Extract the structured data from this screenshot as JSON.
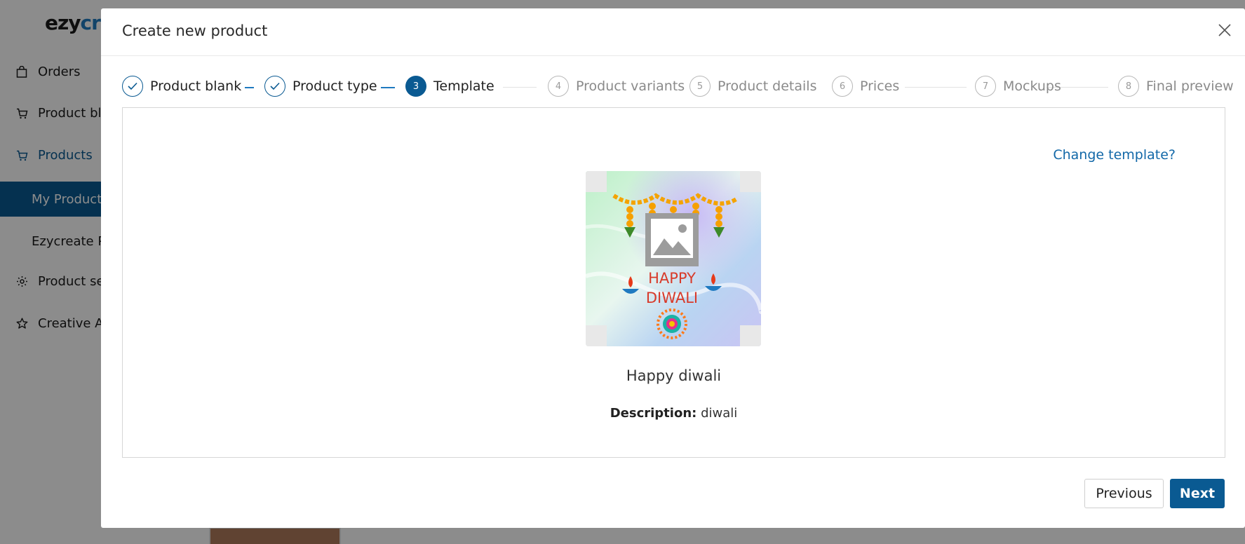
{
  "app": {
    "logo_part1": "ezy",
    "logo_part2": "cre",
    "sidebar": {
      "orders": "Orders",
      "product_blanks": "Product bla",
      "products": "Products",
      "my_products": "My Products",
      "ezycreate_products": "Ezycreate P",
      "product_settings": "Product se",
      "creative_assets": "Creative A"
    }
  },
  "modal": {
    "title": "Create new product",
    "steps": [
      {
        "number": "1",
        "label": "Product blank",
        "state": "done"
      },
      {
        "number": "2",
        "label": "Product type",
        "state": "done"
      },
      {
        "number": "3",
        "label": "Template",
        "state": "current"
      },
      {
        "number": "4",
        "label": "Product variants",
        "state": "pending"
      },
      {
        "number": "5",
        "label": "Product details",
        "state": "pending"
      },
      {
        "number": "6",
        "label": "Prices",
        "state": "pending"
      },
      {
        "number": "7",
        "label": "Mockups",
        "state": "pending"
      },
      {
        "number": "8",
        "label": "Final preview",
        "state": "pending"
      }
    ],
    "change_template_link": "Change template?",
    "template": {
      "image_text_line1": "HAPPY",
      "image_text_line2": "DIWALI",
      "name": "Happy diwali",
      "description_label": "Description:",
      "description_value": "diwali"
    },
    "previous_button": "Previous",
    "next_button": "Next"
  },
  "colors": {
    "primary": "#0a5a92",
    "link": "#1268a8"
  }
}
